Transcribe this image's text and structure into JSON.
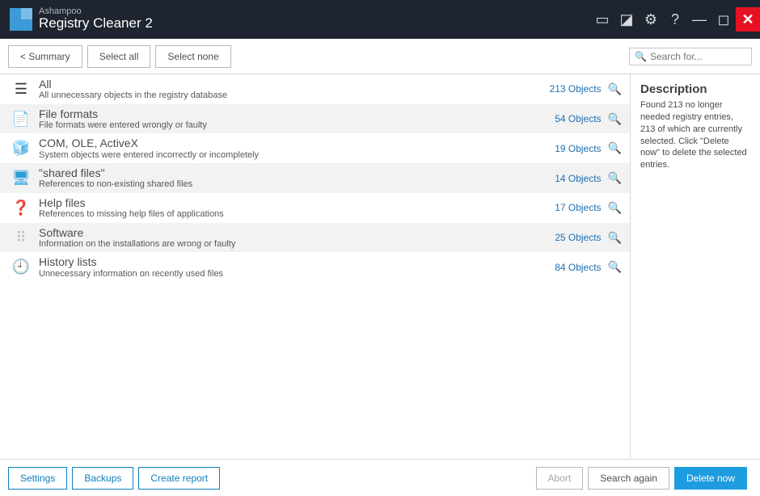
{
  "brand": "Ashampoo",
  "product": "Registry Cleaner 2",
  "topbar": {
    "summary": "< Summary",
    "select_all": "Select all",
    "select_none": "Select none",
    "search_placeholder": "Search for..."
  },
  "categories": [
    {
      "title": "All",
      "desc": "All unnecessary objects in the registry database",
      "obj": "213 Objects",
      "icon": "☰",
      "color": "#333"
    },
    {
      "title": "File formats",
      "desc": "File formats were entered wrongly or faulty",
      "obj": "54 Objects",
      "icon": "📄",
      "color": "#2b9dd8"
    },
    {
      "title": "COM, OLE, ActiveX",
      "desc": "System objects were entered incorrectly or incompletely",
      "obj": "19 Objects",
      "icon": "🧊",
      "color": "#e0a32e"
    },
    {
      "title": "\"shared files\"",
      "desc": "References to non-existing shared files",
      "obj": "14 Objects",
      "icon": "🖥",
      "color": "#2b9dd8"
    },
    {
      "title": "Help files",
      "desc": "References to missing help files of applications",
      "obj": "17 Objects",
      "icon": "❓",
      "color": "#46b36b"
    },
    {
      "title": "Software",
      "desc": "Information on the installations are wrong or faulty",
      "obj": "25 Objects",
      "icon": "⠿",
      "color": "#bdbdbd"
    },
    {
      "title": "History lists",
      "desc": "Unnecessary information on recently used files",
      "obj": "84 Objects",
      "icon": "🕘",
      "color": "#c0392b"
    }
  ],
  "side": {
    "heading": "Description",
    "text": "Found 213 no longer needed registry entries, 213 of which are currently selected. Click \"Delete now\" to delete the selected entries."
  },
  "footer": {
    "settings": "Settings",
    "backups": "Backups",
    "create_report": "Create report",
    "abort": "Abort",
    "search_again": "Search again",
    "delete_now": "Delete now"
  }
}
